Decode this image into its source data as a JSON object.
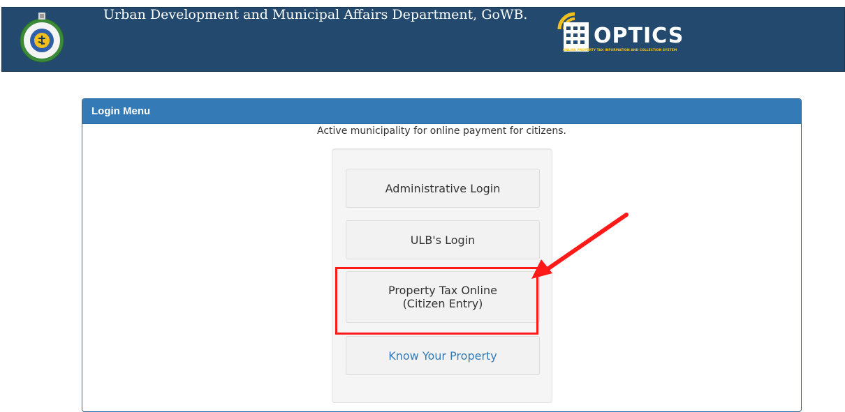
{
  "header": {
    "title": "Urban Development and Municipal Affairs Department, GoWB.",
    "logo_word": "OPTICS",
    "logo_subtitle": "ONLINE PROPERTY TAX INFORMATION AND COLLECTION SYSTEM"
  },
  "panel": {
    "heading": "Login Menu",
    "caption": "Active municipality for online payment for citizens.",
    "buttons": [
      {
        "lines": [
          "Administrative Login"
        ]
      },
      {
        "lines": [
          "ULB's Login"
        ]
      },
      {
        "lines": [
          "Property Tax Online",
          "(Citizen Entry)"
        ]
      },
      {
        "lines": [
          "Know Your Property"
        ]
      }
    ]
  },
  "colors": {
    "header_bg": "#234a6e",
    "panel_heading_bg": "#337ab7",
    "link": "#337ab7",
    "annotation": "#ff1a1a",
    "logo_accent": "#f2c01e"
  },
  "icons": {
    "emblem": "west-bengal-emblem-icon",
    "logo": "optics-logo-icon",
    "annotation_arrow": "red-arrow-icon"
  }
}
